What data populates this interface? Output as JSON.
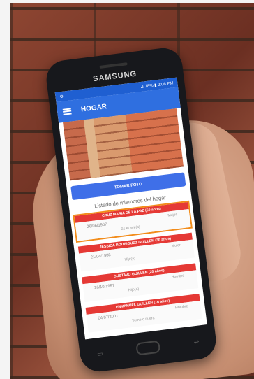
{
  "phone": {
    "brand": "SAMSUNG"
  },
  "status": {
    "right": "⊿ 78% ▮ 2:06 PM"
  },
  "app": {
    "title": "HOGAR"
  },
  "actions": {
    "photo_button": "TOMAR FOTO"
  },
  "list": {
    "title": "Listado de miembros del hogar",
    "members": [
      {
        "name": "CRUZ MARIA DE LA PAZ (50 años)",
        "date": "26/06/1967",
        "sex": "Mujer",
        "relation": "Es el jefe(a)",
        "highlight": true
      },
      {
        "name": "JESSICA RODRIGUEZ GUILLEN (30 años)",
        "date": "21/04/1988",
        "sex": "Mujer",
        "relation": "Hijo(a)",
        "highlight": false
      },
      {
        "name": "GUSTAVO GUILLEN (20 años)",
        "date": "26/10/1997",
        "sex": "Hombre",
        "relation": "Hijo(a)",
        "highlight": false
      },
      {
        "name": "ENMANUEL GUILLEN (16 años)",
        "date": "04/07/2001",
        "sex": "Hombre",
        "relation": "Yerno o nuera",
        "highlight": false
      }
    ]
  },
  "colors": {
    "accent": "#2f6fe0",
    "header": "#e53935",
    "highlight": "#f28c1a"
  }
}
